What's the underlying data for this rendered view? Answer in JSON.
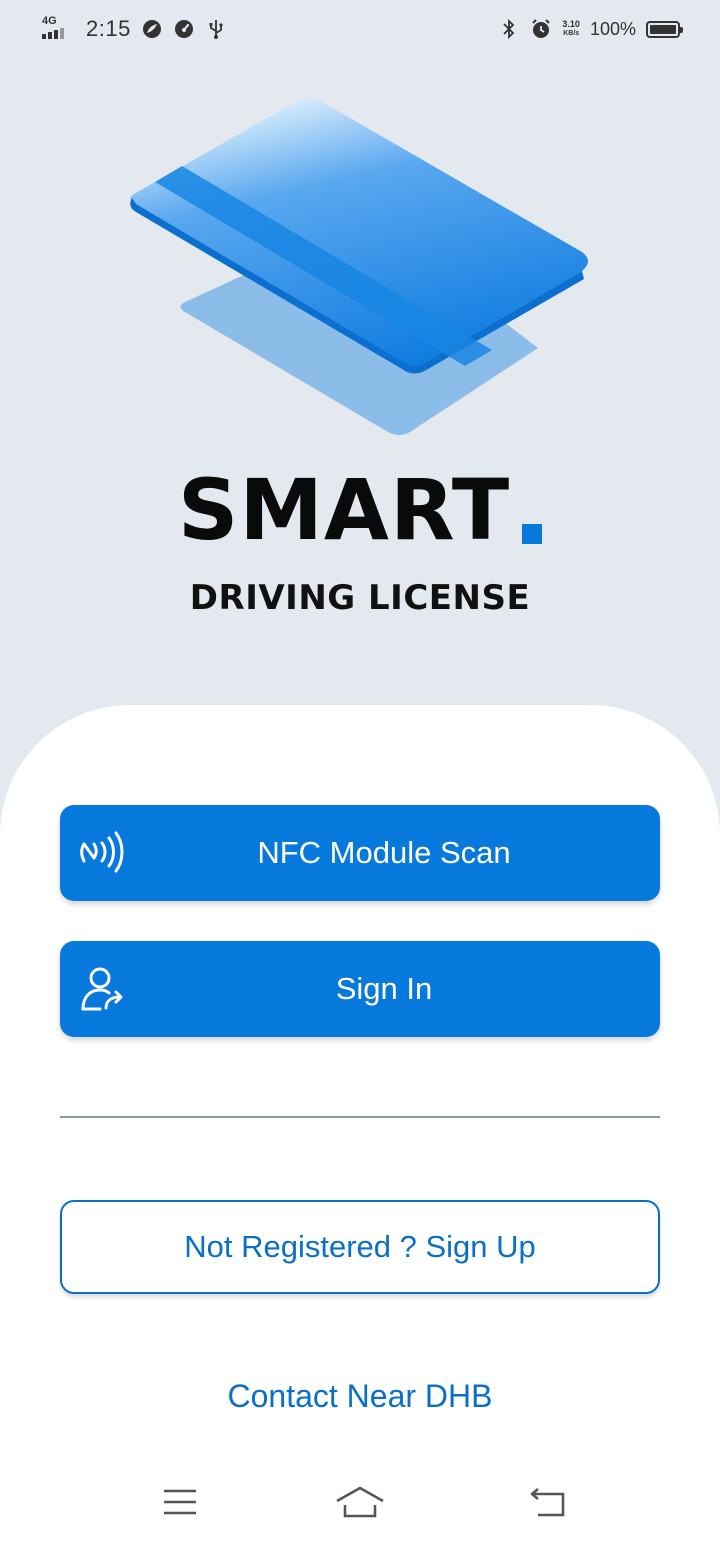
{
  "status_bar": {
    "network": "4G",
    "time": "2:15",
    "speed_value": "3.10",
    "speed_unit": "KB/s",
    "battery": "100%"
  },
  "brand": {
    "title": "SMART",
    "subtitle": "DRIVING LICENSE",
    "accent_color": "#0778dc"
  },
  "actions": {
    "nfc": {
      "label": "NFC Module Scan",
      "icon": "nfc-icon"
    },
    "sign_in": {
      "label": "Sign In",
      "icon": "user-login-icon"
    },
    "sign_up": {
      "label": "Not Registered ? Sign Up"
    },
    "contact": {
      "label": "Contact Near DHB"
    }
  },
  "nav_bar": {
    "icons": [
      "menu-icon",
      "home-icon",
      "back-icon"
    ]
  },
  "colors": {
    "background": "#e3e9ee",
    "primary": "#0778dc",
    "link": "#0a6fc8",
    "sheet": "#ffffff"
  }
}
